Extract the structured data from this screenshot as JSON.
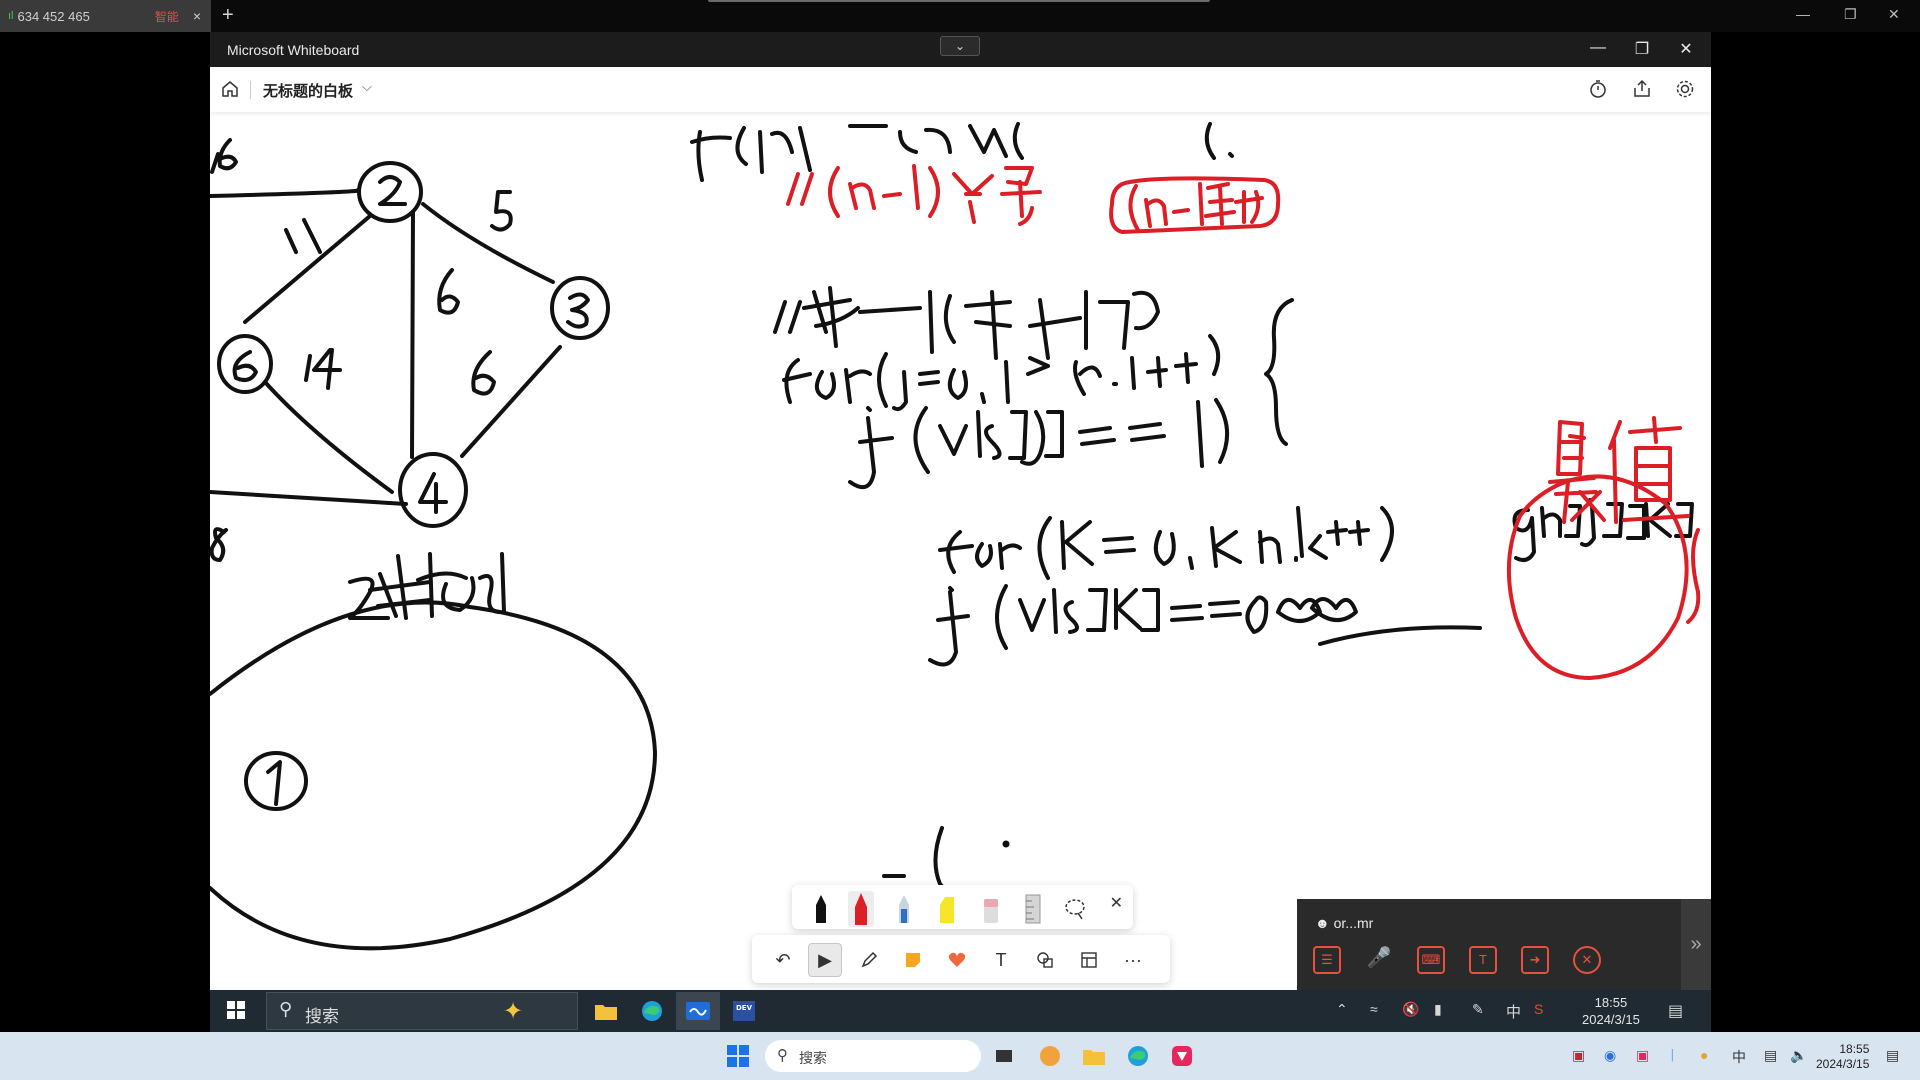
{
  "host_browser": {
    "tab_signal": "ıl",
    "tab_title": "634 452 465",
    "tab_badge": "智能",
    "tab_close": "×",
    "new_tab": "+"
  },
  "window": {
    "title": "Microsoft Whiteboard",
    "collapse_glyph": "⌄"
  },
  "appbar": {
    "board_title": "无标题的白板",
    "board_chevron": "⌵"
  },
  "ink": {
    "colors": {
      "black": "#111111",
      "red": "#dc1f26"
    }
  },
  "pen_tray": {
    "colors": [
      "#111111",
      "#dc1f26",
      "#2f6fbf",
      "#f5e62a",
      "#e9a9b0"
    ],
    "close": "✕"
  },
  "toolbar": {
    "undo": "↶",
    "select": "▶",
    "text": "T",
    "more": "···"
  },
  "meeting": {
    "user_label": "or...mr",
    "buttons": [
      "chat",
      "mic",
      "keyboard",
      "text-box",
      "folder",
      "end-call"
    ],
    "expand": "»"
  },
  "inner_taskbar": {
    "search_label": "搜索",
    "ime": "中",
    "clock_time": "18:55",
    "clock_date": "2024/3/15"
  },
  "host_taskbar": {
    "search_label": "搜索",
    "ime": "中",
    "clock_time": "18:55",
    "clock_date": "2024/3/15"
  }
}
